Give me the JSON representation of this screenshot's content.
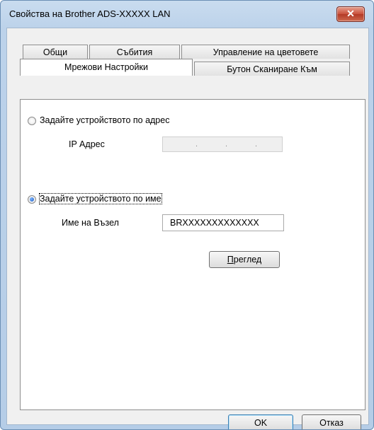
{
  "window": {
    "title": "Свойства на Brother ADS-XXXXX LAN",
    "close_glyph": "✕"
  },
  "tabs": {
    "row1": [
      "Общи",
      "Събития",
      "Управление на цветовете"
    ],
    "row2": [
      "Мрежови Настройки",
      "Бутон Сканиране Към"
    ],
    "active": "Мрежови Настройки"
  },
  "address_option": {
    "label": "Задайте устройството по адрес",
    "selected": false,
    "ip_label": "IP Адрес",
    "ip_value": ". . ."
  },
  "name_option": {
    "label": "Задайте устройството по име",
    "selected": true,
    "node_label": "Име на Възел",
    "node_value": "BRXXXXXXXXXXXXX"
  },
  "browse_button": {
    "label_underlined": "П",
    "label_rest": "реглед"
  },
  "footer": {
    "ok_label": "OK",
    "cancel_label": "Отказ"
  }
}
